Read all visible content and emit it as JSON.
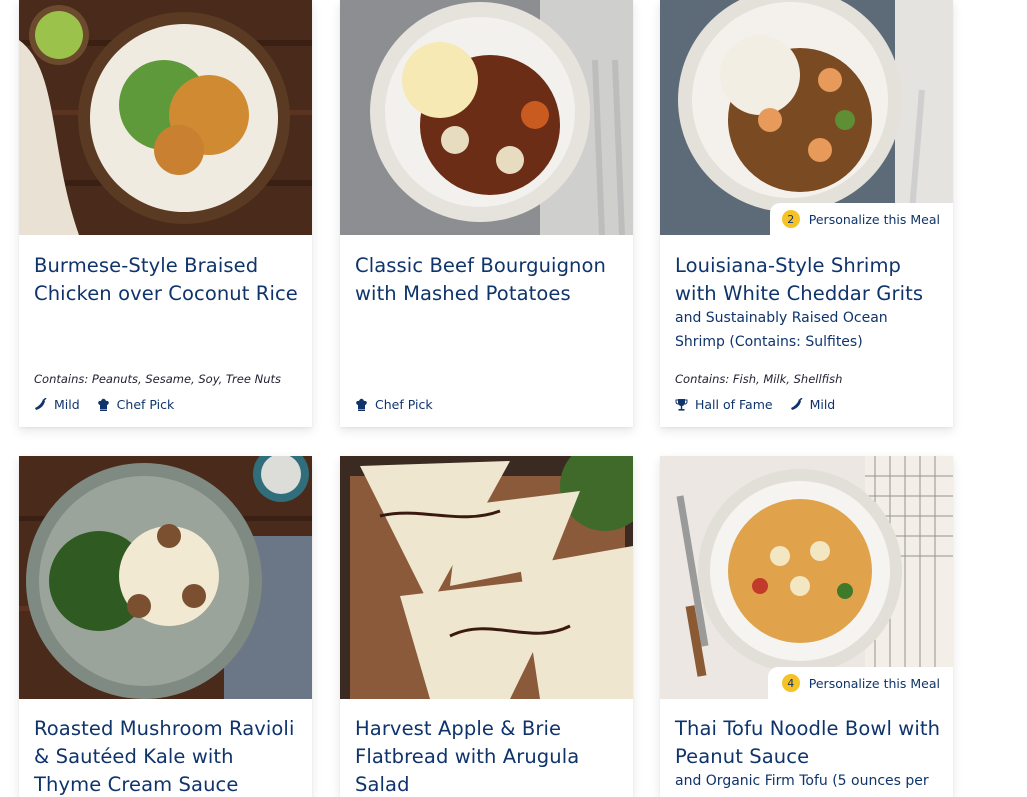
{
  "meals": [
    {
      "title": "Burmese-Style Braised Chicken over Coconut Rice",
      "subtitle": "",
      "allergens": "Contains: Peanuts, Sesame, Soy, Tree Nuts",
      "tags": [
        {
          "icon": "pepper-icon",
          "label": "Mild"
        },
        {
          "icon": "chef-hat-icon",
          "label": "Chef Pick"
        }
      ]
    },
    {
      "title": "Classic Beef Bourguignon with Mashed Potatoes",
      "subtitle": "",
      "allergens": "",
      "tags": [
        {
          "icon": "chef-hat-icon",
          "label": "Chef Pick"
        }
      ]
    },
    {
      "title": "Louisiana-Style Shrimp with White Cheddar Grits",
      "subtitle": "and Sustainably Raised Ocean Shrimp (Contains: Sulfites)",
      "allergens": "Contains: Fish, Milk, Shellfish",
      "badge": {
        "count": "2",
        "label": "Personalize this Meal"
      },
      "tags": [
        {
          "icon": "trophy-icon",
          "label": "Hall of Fame"
        },
        {
          "icon": "pepper-icon",
          "label": "Mild"
        }
      ]
    },
    {
      "title": "Roasted Mushroom Ravioli & Sautéed Kale with Thyme Cream Sauce"
    },
    {
      "title": "Harvest Apple & Brie Flatbread with Arugula Salad"
    },
    {
      "title": "Thai Tofu Noodle Bowl with Peanut Sauce",
      "subtitle": "and Organic Firm Tofu (5 ounces per",
      "badge": {
        "count": "4",
        "label": "Personalize this Meal"
      }
    }
  ],
  "colors": {
    "brand_text": "#0f346c",
    "badge_yellow": "#f6c327"
  }
}
